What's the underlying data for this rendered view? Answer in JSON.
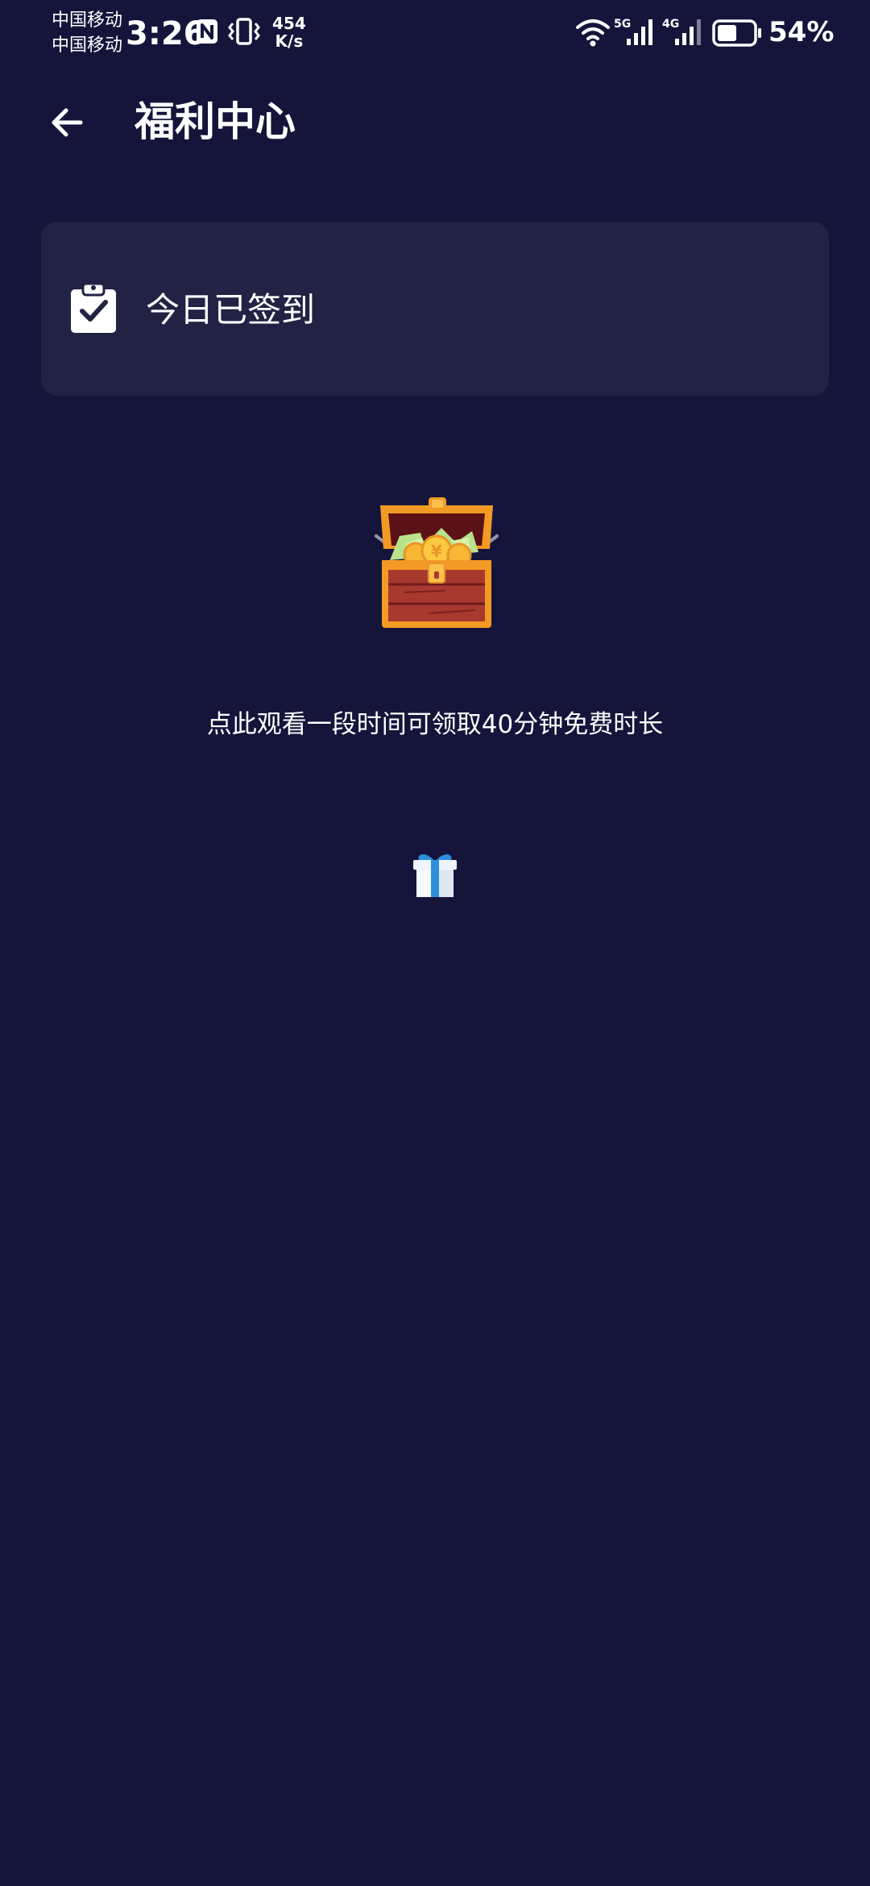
{
  "status_bar": {
    "carrier_1": "中国移动",
    "carrier_2": "中国移动",
    "time": "3:26",
    "net_speed_value": "454",
    "net_speed_unit": "K/s",
    "signal_1_label": "5G",
    "signal_2_label": "4G",
    "battery_percent": "54%",
    "battery_level": 0.54
  },
  "header": {
    "title": "福利中心",
    "back_icon": "arrow-left-icon"
  },
  "checkin_card": {
    "icon": "clipboard-check-icon",
    "label": "今日已签到"
  },
  "reward": {
    "icon": "treasure-chest-icon",
    "text": "点此观看一段时间可领取40分钟免费时长",
    "gift_icon": "gift-box-icon"
  },
  "colors": {
    "background": "#15153b",
    "card": "#222244",
    "text": "#ffffff",
    "chest_orange": "#f39a25",
    "chest_wood": "#a8392f"
  }
}
